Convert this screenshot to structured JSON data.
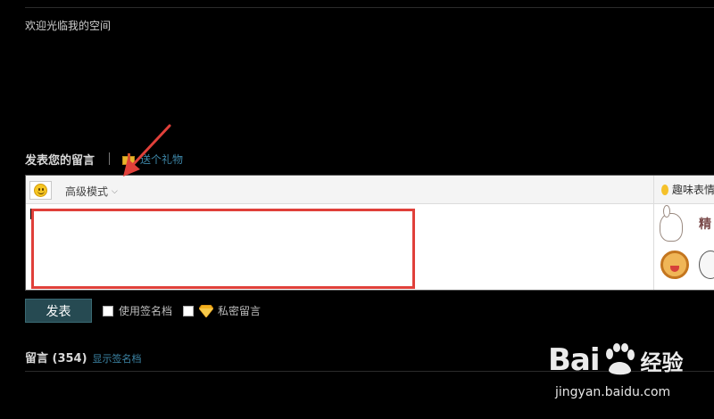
{
  "welcome_text": "欢迎光临我的空间",
  "compose": {
    "title": "发表您的留言",
    "gift_link": "送个礼物",
    "mode_label": "高级模式",
    "emote_panel_label": "趣味表情",
    "emote_sample_text": "精"
  },
  "submit": {
    "publish_label": "发表",
    "signature_option": "使用签名档",
    "private_option": "私密留言"
  },
  "messages": {
    "title": "留言 (354)",
    "show_signature_link": "显示签名档"
  },
  "watermark": {
    "brand": "Bai",
    "product": "经验",
    "url": "jingyan.baidu.com"
  },
  "colors": {
    "background": "#000000",
    "link": "#3d86a7",
    "publish_button": "#264a52",
    "highlight_box": "#e0403a",
    "annotation_arrow": "#e0403a"
  },
  "icons": [
    "smiley-icon",
    "gift-icon",
    "chevron-down-icon",
    "diamond-icon",
    "emote-smiley-icon"
  ]
}
